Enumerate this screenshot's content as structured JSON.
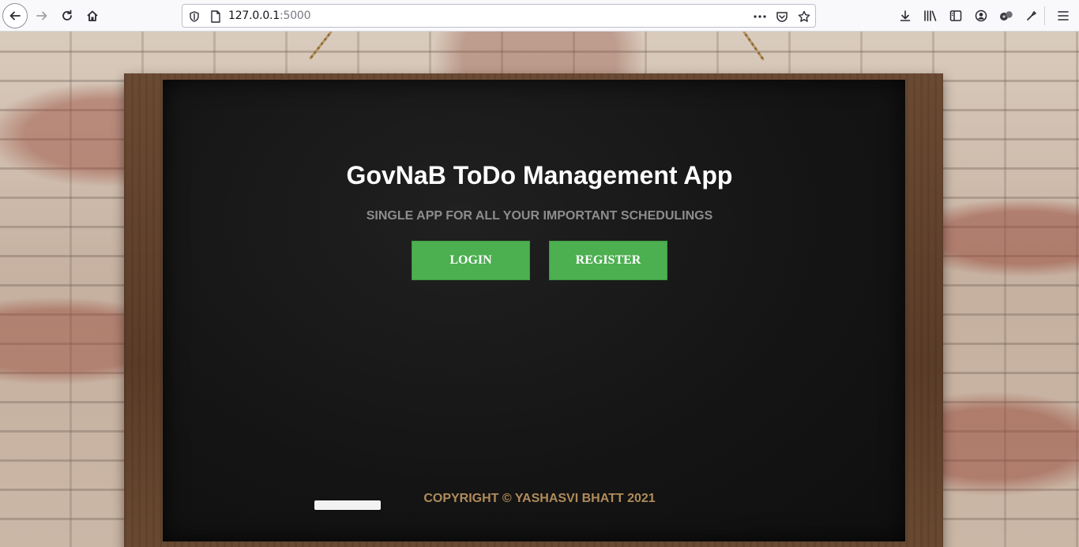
{
  "browser": {
    "url_host": "127.0.0.1",
    "url_port": ":5000",
    "icons": {
      "back": "back-arrow-icon",
      "forward": "forward-arrow-icon",
      "reload": "reload-icon",
      "home": "home-icon",
      "tracking": "shield-icon",
      "page": "page-icon",
      "more": "more-dots-icon",
      "pocket": "pocket-icon",
      "bookmark": "star-icon",
      "downloads": "download-icon",
      "library": "library-icon",
      "sidebar": "sidebar-icon",
      "account": "account-icon",
      "extension": "extension-icon",
      "extension2": "extension-puzzle-icon",
      "menu": "hamburger-menu-icon"
    }
  },
  "app": {
    "title": "GovNaB ToDo Management App",
    "subtitle": "SINGLE APP FOR ALL YOUR IMPORTANT SCHEDULINGS",
    "login_label": "LOGIN",
    "register_label": "REGISTER",
    "footer": "COPYRIGHT © YASHASVI BHATT 2021"
  },
  "colors": {
    "button": "#4caf50",
    "board": "#141414",
    "frame": "#5a3c28",
    "subtitle": "#8d8d8d",
    "footer": "#b08b5a"
  }
}
